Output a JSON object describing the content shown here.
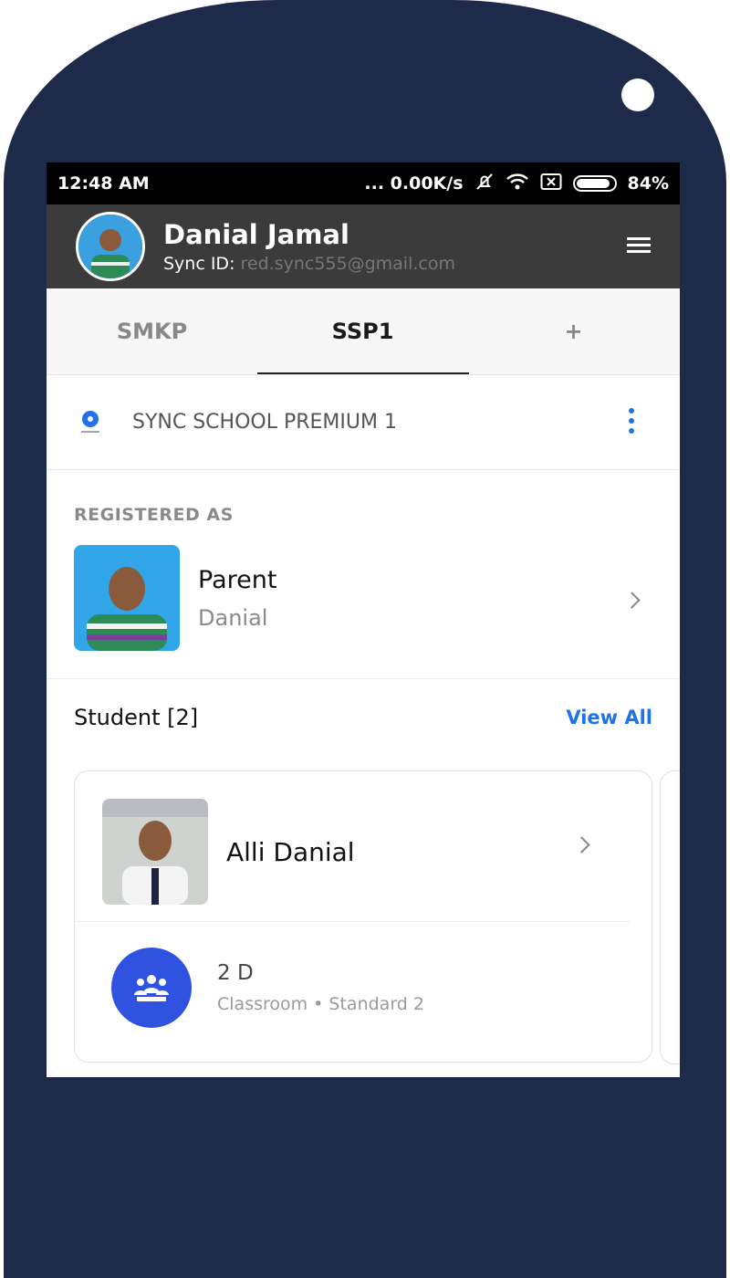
{
  "status_bar": {
    "time": "12:48 AM",
    "network_speed": "... 0.00K/s",
    "battery": "84%"
  },
  "header": {
    "user_name": "Danial Jamal",
    "sync_label": "Sync ID:",
    "sync_email": "red.sync555@gmail.com"
  },
  "tabs": [
    {
      "label": "SMKP"
    },
    {
      "label": "SSP1",
      "active": true
    },
    {
      "label": "+"
    }
  ],
  "school": {
    "name": "SYNC SCHOOL PREMIUM 1"
  },
  "registered": {
    "section_label": "REGISTERED AS",
    "role": "Parent",
    "name": "Danial"
  },
  "students": {
    "title": "Student [2]",
    "view_all": "View All",
    "items": [
      {
        "name": "Alli Danial",
        "class_name": "2 D",
        "class_sub": "Classroom • Standard 2"
      }
    ]
  },
  "colors": {
    "accent": "#1e73e8",
    "header_bg": "#3b3b3b",
    "phone_frame": "#1d2a4a",
    "class_icon_bg": "#2f52e0"
  }
}
